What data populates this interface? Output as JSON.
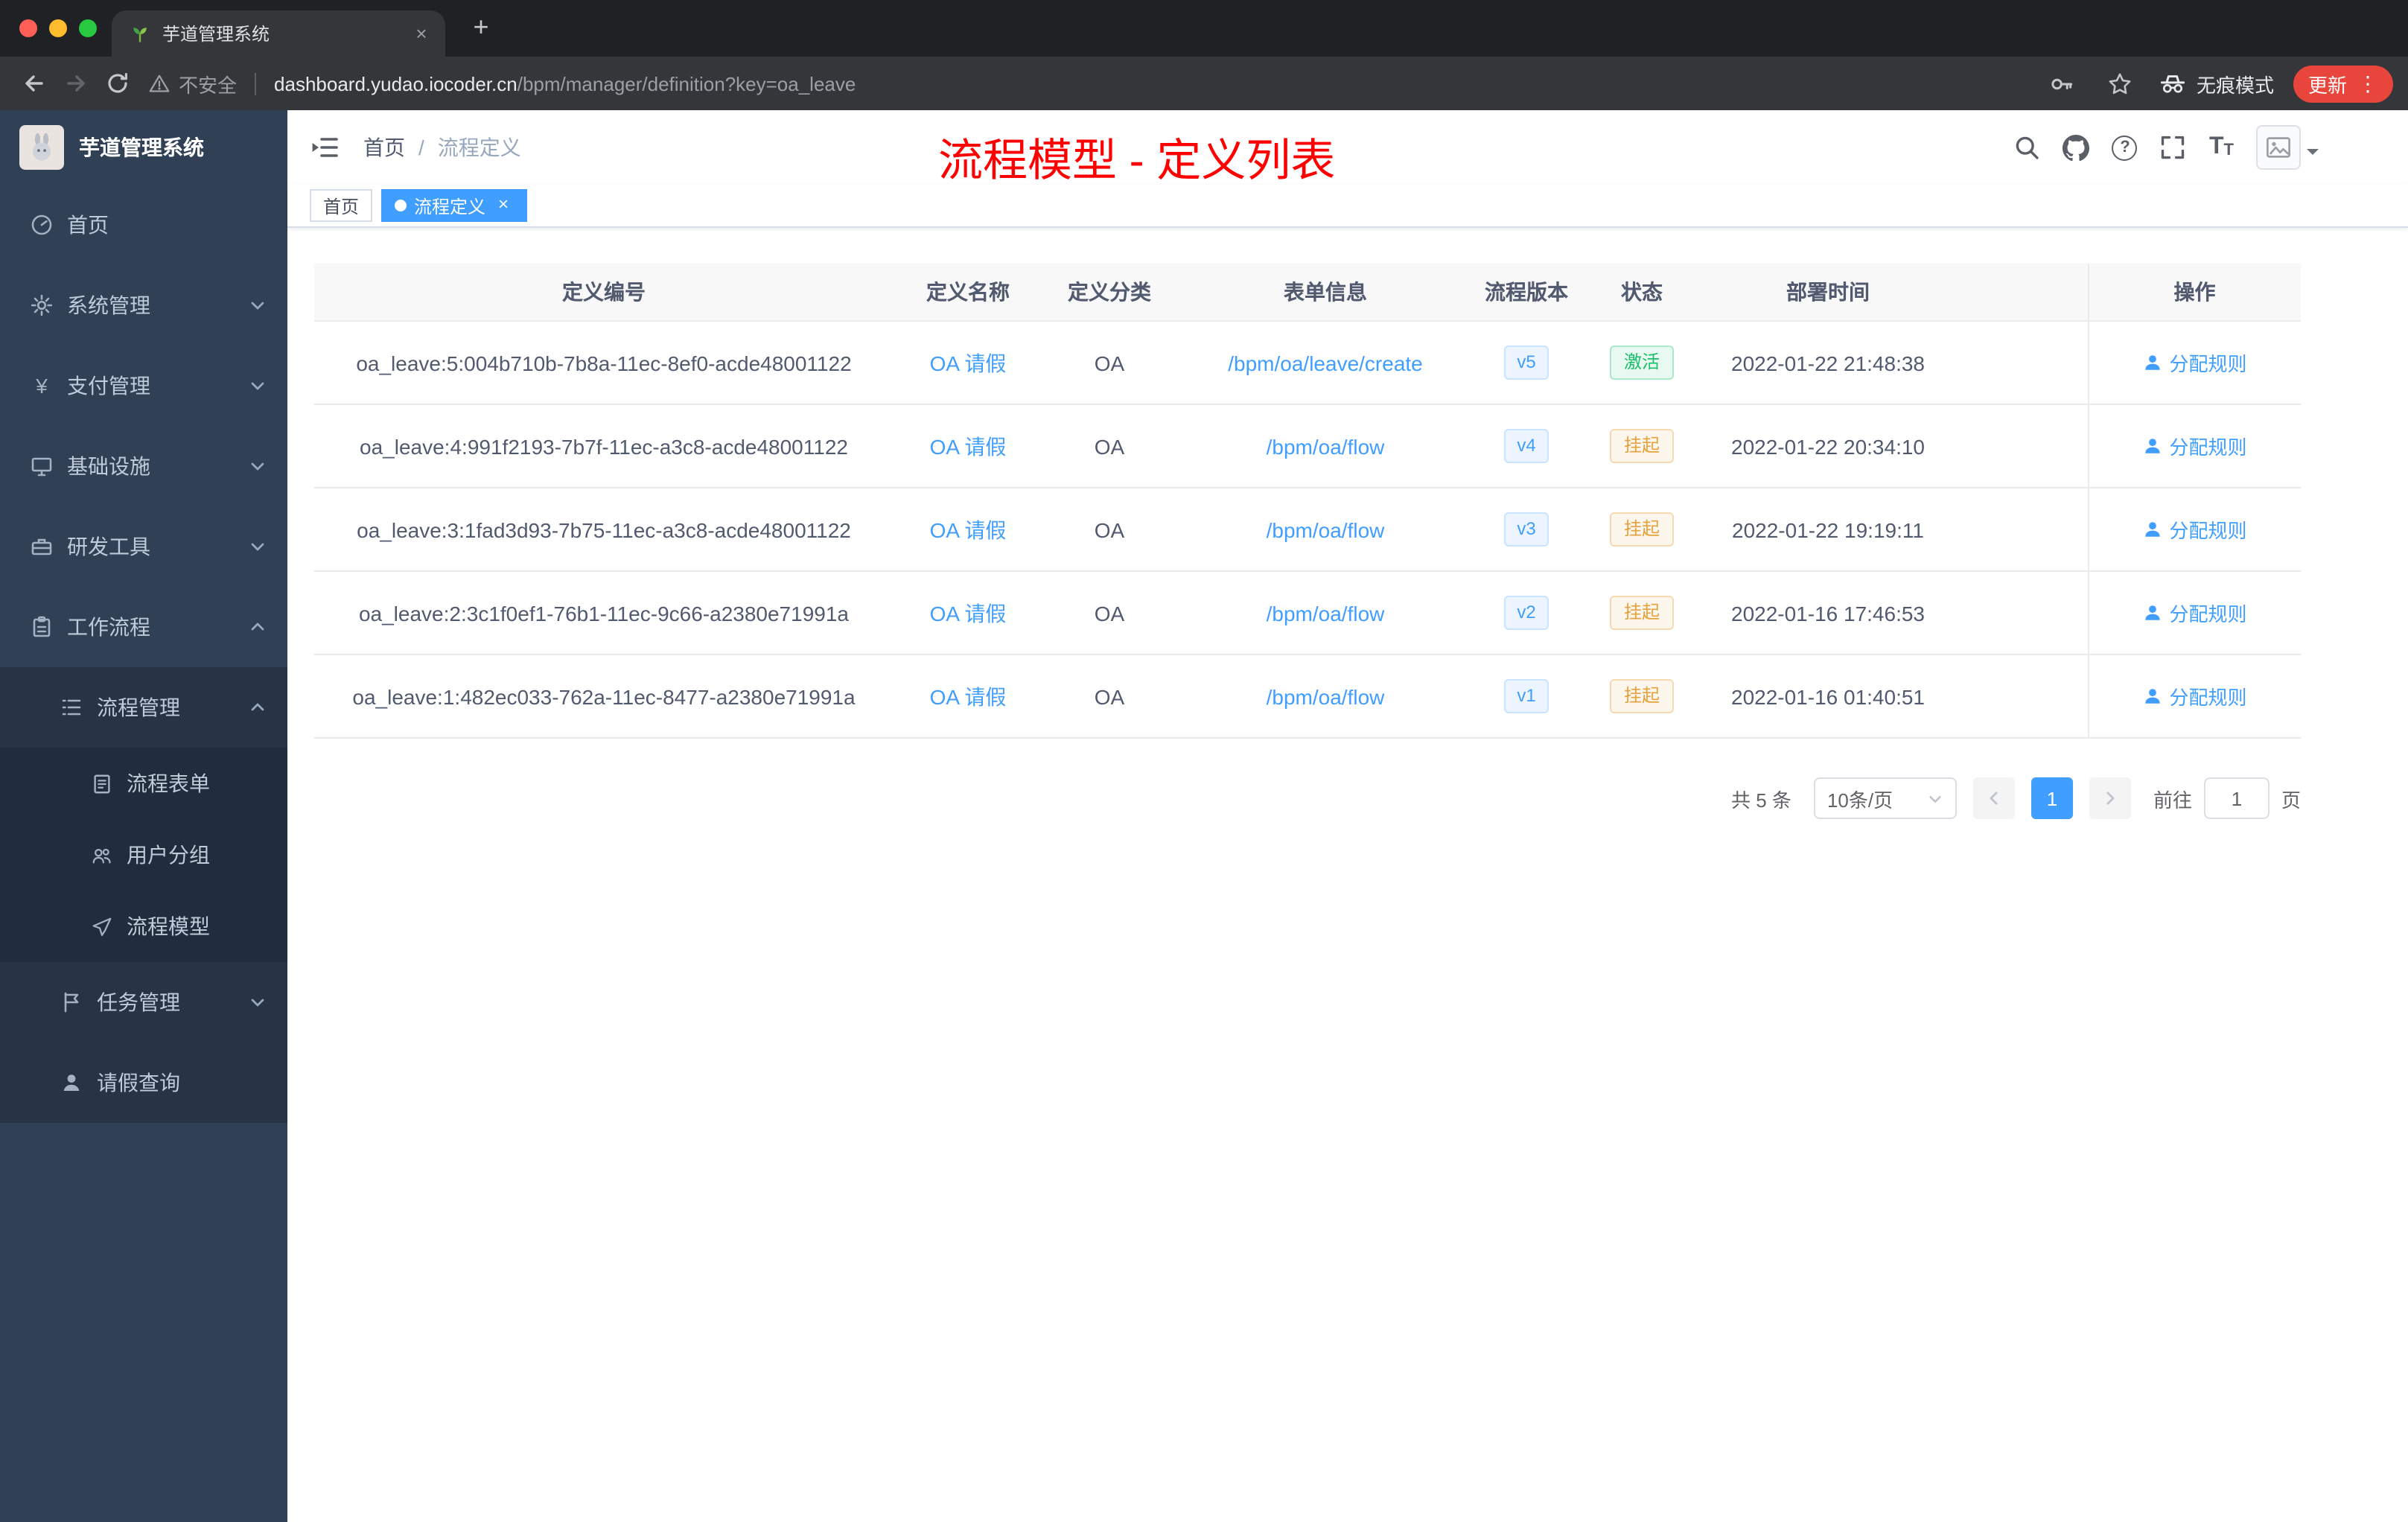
{
  "browser": {
    "tab": {
      "title": "芋道管理系统"
    },
    "toolbar": {
      "security_label": "不安全",
      "url_domain": "dashboard.yudao.iocoder.cn",
      "url_path": "/bpm/manager/definition?key=oa_leave",
      "incognito_label": "无痕模式",
      "update_label": "更新"
    }
  },
  "sidebar": {
    "brand": "芋道管理系统",
    "items": [
      {
        "label": "首页"
      },
      {
        "label": "系统管理"
      },
      {
        "label": "支付管理"
      },
      {
        "label": "基础设施"
      },
      {
        "label": "研发工具"
      },
      {
        "label": "工作流程"
      },
      {
        "label": "流程管理"
      },
      {
        "label": "流程表单"
      },
      {
        "label": "用户分组"
      },
      {
        "label": "流程模型"
      },
      {
        "label": "任务管理"
      },
      {
        "label": "请假查询"
      }
    ]
  },
  "navbar": {
    "breadcrumb": {
      "home": "首页",
      "current": "流程定义"
    },
    "annotation": "流程模型 - 定义列表"
  },
  "tags": {
    "items": [
      {
        "label": "首页"
      },
      {
        "label": "流程定义"
      }
    ]
  },
  "table": {
    "columns": [
      "定义编号",
      "定义名称",
      "定义分类",
      "表单信息",
      "流程版本",
      "状态",
      "部署时间",
      "操作"
    ],
    "rows": [
      {
        "id": "oa_leave:5:004b710b-7b8a-11ec-8ef0-acde48001122",
        "name": "OA 请假",
        "category": "OA",
        "form": "/bpm/oa/leave/create",
        "version": "v5",
        "status": "激活",
        "deploy_time": "2022-01-22 21:48:38",
        "action": "分配规则"
      },
      {
        "id": "oa_leave:4:991f2193-7b7f-11ec-a3c8-acde48001122",
        "name": "OA 请假",
        "category": "OA",
        "form": "/bpm/oa/flow",
        "version": "v4",
        "status": "挂起",
        "deploy_time": "2022-01-22 20:34:10",
        "action": "分配规则"
      },
      {
        "id": "oa_leave:3:1fad3d93-7b75-11ec-a3c8-acde48001122",
        "name": "OA 请假",
        "category": "OA",
        "form": "/bpm/oa/flow",
        "version": "v3",
        "status": "挂起",
        "deploy_time": "2022-01-22 19:19:11",
        "action": "分配规则"
      },
      {
        "id": "oa_leave:2:3c1f0ef1-76b1-11ec-9c66-a2380e71991a",
        "name": "OA 请假",
        "category": "OA",
        "form": "/bpm/oa/flow",
        "version": "v2",
        "status": "挂起",
        "deploy_time": "2022-01-16 17:46:53",
        "action": "分配规则"
      },
      {
        "id": "oa_leave:1:482ec033-762a-11ec-8477-a2380e71991a",
        "name": "OA 请假",
        "category": "OA",
        "form": "/bpm/oa/flow",
        "version": "v1",
        "status": "挂起",
        "deploy_time": "2022-01-16 01:40:51",
        "action": "分配规则"
      }
    ]
  },
  "pagination": {
    "total": "共 5 条",
    "page_size": "10条/页",
    "current_page": "1",
    "goto_label": "前往",
    "goto_value": "1",
    "page_unit": "页"
  },
  "colors": {
    "accent": "#409eff",
    "annotation_red": "#ff0000",
    "success_green": "#19be6b",
    "warning_orange": "#e6a23c",
    "sidebar_dark": "#304156"
  }
}
